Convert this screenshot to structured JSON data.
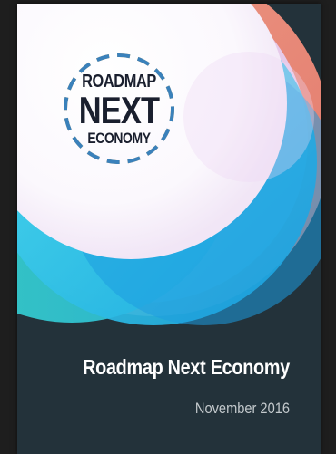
{
  "cover": {
    "logo": {
      "line1": "ROADMAP",
      "line2": "NEXT",
      "line3": "ECONOMY"
    },
    "title": "Roadmap Next Economy",
    "date": "November 2016",
    "colors": {
      "background": "#23323a",
      "logo_ring_orange": "#f2a33a",
      "logo_ring_blue": "#2f7fc2",
      "logo_text": "#1a1f2e",
      "accent_cyan": "#22c6e6",
      "accent_pink": "#f28c7c",
      "accent_lavender": "#e4cdf0"
    }
  }
}
